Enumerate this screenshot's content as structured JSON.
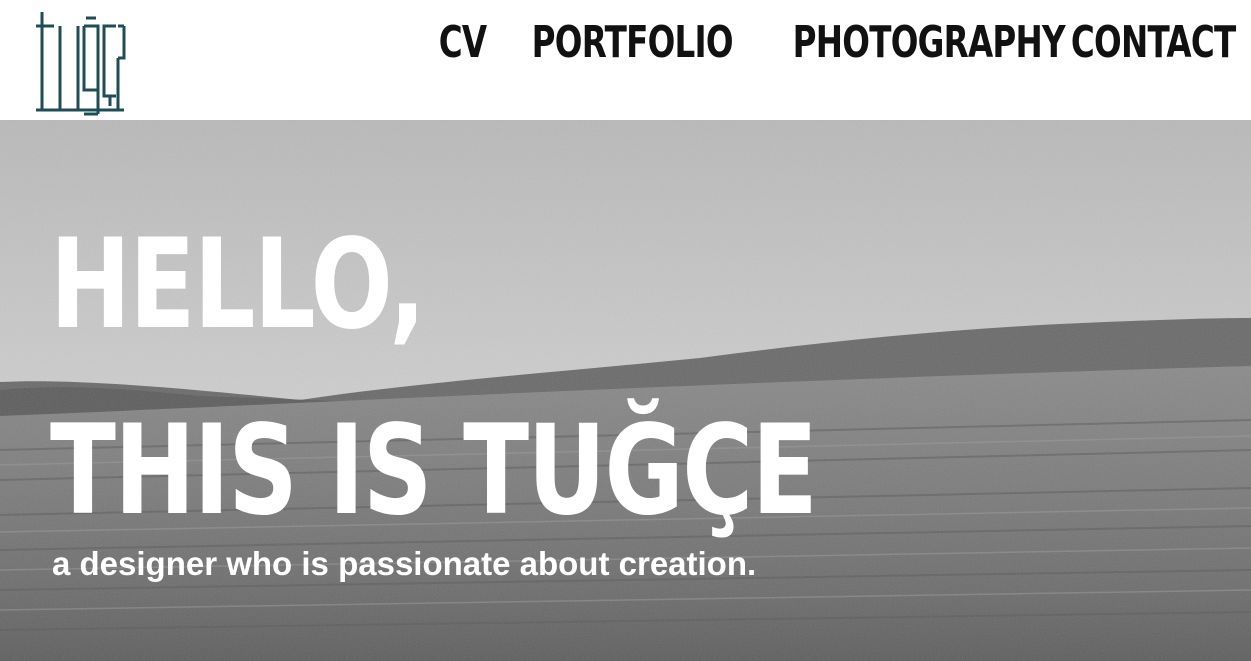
{
  "logo": {
    "text": "tuğçe",
    "color": "#1e4d56"
  },
  "nav": {
    "items": [
      {
        "label": "CV"
      },
      {
        "label": "PORTFOLIO"
      },
      {
        "label": "PHOTOGRAPHY"
      },
      {
        "label": "CONTACT"
      }
    ]
  },
  "hero": {
    "title_line1": "HELLO,",
    "title_line2": "THIS IS TUĞÇE",
    "subtitle": "a designer who is passionate about creation.",
    "background": "black-and-white sea photograph"
  }
}
